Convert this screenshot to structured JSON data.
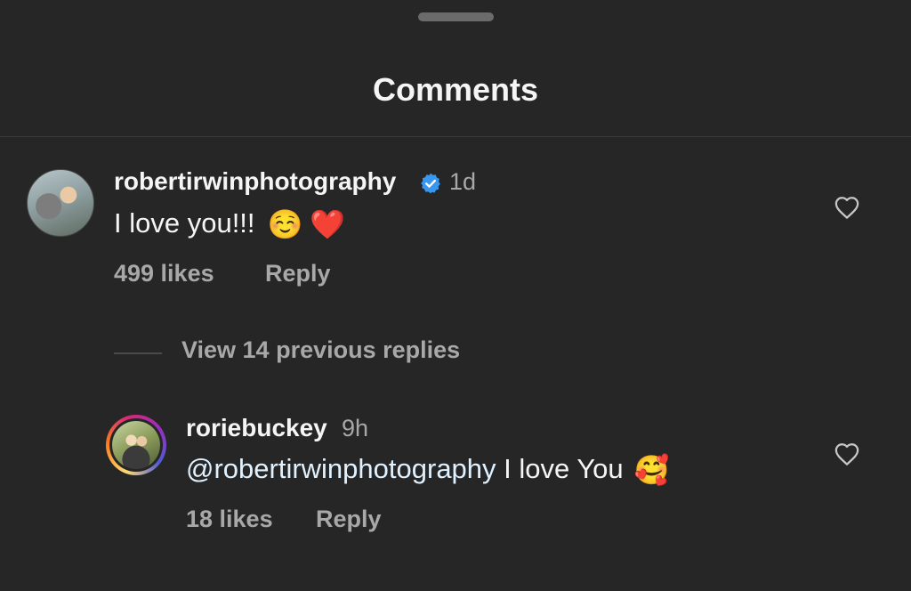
{
  "sheet": {
    "title": "Comments"
  },
  "comments": [
    {
      "username": "robertirwinphotography",
      "verified": true,
      "time": "1d",
      "text": "I love you!!!",
      "emojis": [
        "☺️",
        "❤️"
      ],
      "likes": "499 likes",
      "reply_label": "Reply"
    }
  ],
  "view_replies": {
    "label": "View 14 previous replies"
  },
  "replies": [
    {
      "username": "roriebuckey",
      "time": "9h",
      "mention": "@robertirwinphotography",
      "text": "I love You",
      "emoji": "🥰",
      "likes": "18 likes",
      "reply_label": "Reply"
    }
  ],
  "colors": {
    "background": "#262626",
    "primary_text": "#f5f5f5",
    "secondary_text": "#a8a8a8",
    "verified_badge": "#3897f0",
    "mention_text": "#e0f1ff"
  },
  "icons": {
    "verified": "verified-badge-icon",
    "like": "heart-outline-icon",
    "grabber": "drag-handle"
  }
}
